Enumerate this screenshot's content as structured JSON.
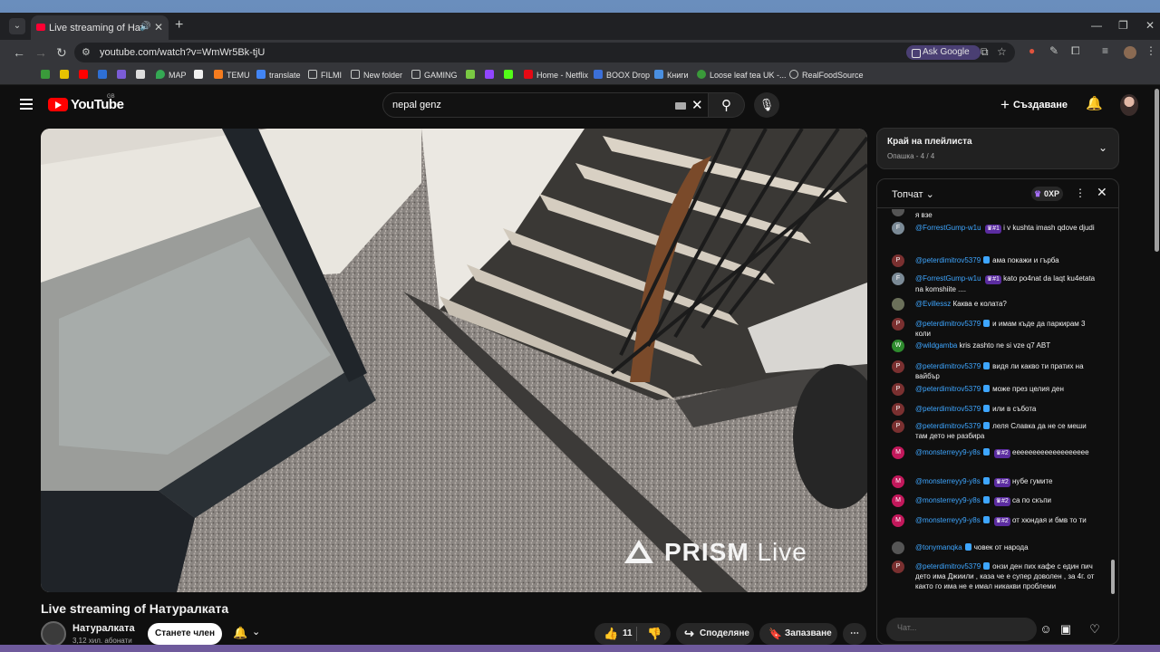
{
  "browser": {
    "tab_title": "Live streaming of Натуралката",
    "url": "youtube.com/watch?v=WmWr5Bk-tjU",
    "ask_google": "Ask Google",
    "bookmarks": [
      "MAP",
      "TEMU",
      "translate",
      "FILMI",
      "New folder",
      "GAMING",
      "Home - Netflix",
      "BOOX Drop",
      "Книги",
      "Loose leaf tea UK -...",
      "RealFoodSource"
    ]
  },
  "youtube": {
    "logo": "YouTube",
    "country": "GB",
    "search_query": "nepal genz",
    "create_label": "Създаване"
  },
  "video": {
    "title": "Live streaming of Натуралката",
    "watermark_a": "PRISM",
    "watermark_b": "Live",
    "channel_name": "Натуралката",
    "channel_subs": "3,12 хил. абонати",
    "join_label": "Станете член",
    "likes": "11",
    "share_label": "Споделяне",
    "save_label": "Запазване"
  },
  "playlist": {
    "title": "Край на плейлиста",
    "subtitle": "Опашка - 4 / 4"
  },
  "chat": {
    "title": "Топчат",
    "xp": "0XP",
    "input_placeholder": "Чат...",
    "partial_top": "я взе",
    "messages": [
      {
        "avatar": "F",
        "color": "#7b8a96",
        "author": "@ForrestGump-w1u",
        "verified": false,
        "badge": "#1",
        "text": "i v kushta imash qdove djudi"
      },
      {
        "avatar": "P",
        "color": "#7a3030",
        "author": "@peterdimitrov5379",
        "verified": true,
        "badge": "",
        "text": "ама покажи и гърба"
      },
      {
        "avatar": "F",
        "color": "#7b8a96",
        "author": "@ForrestGump-w1u",
        "verified": false,
        "badge": "#1",
        "text": "kato po4nat da laqt ku4etata na komshiite ...."
      },
      {
        "avatar": "",
        "color": "#6b705a",
        "author": "@Evillessz",
        "verified": false,
        "badge": "",
        "text": "Каква е колата?"
      },
      {
        "avatar": "P",
        "color": "#7a3030",
        "author": "@peterdimitrov5379",
        "verified": true,
        "badge": "",
        "text": "и имам къде да паркирам 3 коли"
      },
      {
        "avatar": "W",
        "color": "#2e8b2e",
        "author": "@wildgamba",
        "verified": false,
        "badge": "",
        "text": "kris zashto ne si vze q7 ABT"
      },
      {
        "avatar": "P",
        "color": "#7a3030",
        "author": "@peterdimitrov5379",
        "verified": true,
        "badge": "",
        "text": "видя ли какво ти пратих на вайбър"
      },
      {
        "avatar": "P",
        "color": "#7a3030",
        "author": "@peterdimitrov5379",
        "verified": true,
        "badge": "",
        "text": "може през целия ден"
      },
      {
        "avatar": "P",
        "color": "#7a3030",
        "author": "@peterdimitrov5379",
        "verified": true,
        "badge": "",
        "text": "или в събота"
      },
      {
        "avatar": "P",
        "color": "#7a3030",
        "author": "@peterdimitrov5379",
        "verified": true,
        "badge": "",
        "text": "леля Славка да не се меши там дето не разбира"
      },
      {
        "avatar": "M",
        "color": "#c2185b",
        "author": "@monsterreyy9-y8s",
        "verified": true,
        "badge": "#2",
        "text": "еееееееееееееееееее"
      },
      {
        "avatar": "M",
        "color": "#c2185b",
        "author": "@monsterreyy9-y8s",
        "verified": true,
        "badge": "#2",
        "text": "нубе гумите"
      },
      {
        "avatar": "M",
        "color": "#c2185b",
        "author": "@monsterreyy9-y8s",
        "verified": true,
        "badge": "#2",
        "text": "са по скъпи"
      },
      {
        "avatar": "M",
        "color": "#c2185b",
        "author": "@monsterreyy9-y8s",
        "verified": true,
        "badge": "#2",
        "text": "от хюндая и бмв то ти"
      },
      {
        "avatar": "",
        "color": "#555555",
        "author": "@tonymanqka",
        "verified": true,
        "badge": "",
        "text": "човек от народа"
      },
      {
        "avatar": "P",
        "color": "#7a3030",
        "author": "@peterdimitrov5379",
        "verified": true,
        "badge": "",
        "text": "онзи ден пих кафе с един пич дето има Джиили , каза че е супер доволен , за 4г. от както го има не е имал никакви проблеми"
      }
    ]
  }
}
